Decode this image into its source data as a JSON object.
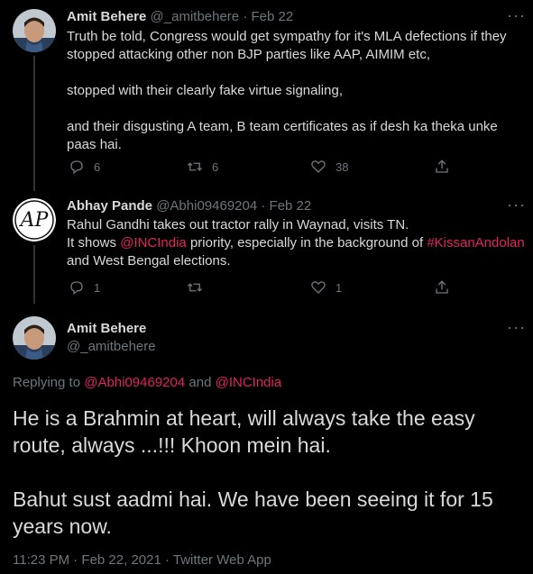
{
  "tweets": [
    {
      "name": "Amit Behere",
      "handle": "@_amitbehere",
      "date": "Feb 22",
      "lines": [
        "Truth be told, Congress would get sympathy for it's MLA defections if they",
        "stopped attacking other non BJP parties like AAP, AIMIM etc,",
        "stopped with their clearly fake virtue signaling,",
        "and their disgusting A team, B team certificates as if desh ka theka unke",
        "paas hai."
      ],
      "replies": "6",
      "retweets": "6",
      "likes": "38"
    },
    {
      "name": "Abhay Pande",
      "handle": "@Abhi09469204",
      "date": "Feb 22",
      "line1": "Rahul Gandhi takes out tractor rally in Waynad, visits TN.",
      "line2_a": "It shows ",
      "line2_link": "@INCIndia",
      "line2_b": " priority, especially in the background of ",
      "line2_link2": "#KissanAndolan",
      "line3": "and West Bengal elections.",
      "replies": "1",
      "retweets": "",
      "likes": "1"
    }
  ],
  "main_tweet": {
    "name": "Amit Behere",
    "handle": "@_amitbehere",
    "replying_prefix": "Replying to ",
    "replying_user1": "@Abhi09469204",
    "replying_and": " and ",
    "replying_user2": "@INCIndia",
    "para1": "He is a Brahmin at heart, will always take the easy route, always ...!!! Khoon mein hai.",
    "para2": "Bahut sust aadmi hai. We have been seeing it for 15 years now.",
    "timestamp": "11:23 PM · Feb 22, 2021 · Twitter Web App"
  },
  "more_glyph": "···",
  "separator": " · ",
  "colors": {
    "background": "#000000",
    "text": "#d9d9d9",
    "muted": "#6e767d",
    "link": "#e0245e"
  }
}
